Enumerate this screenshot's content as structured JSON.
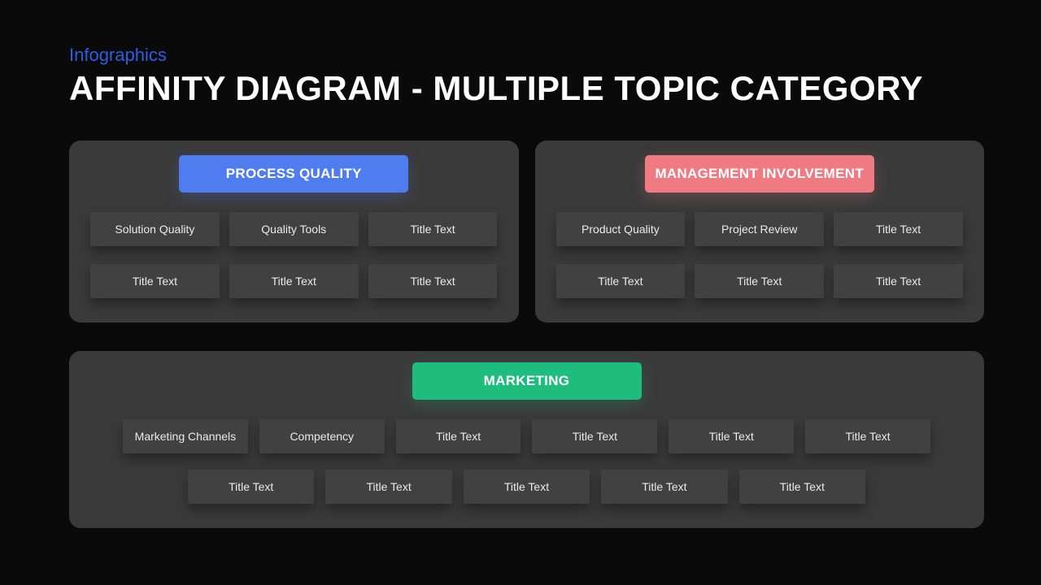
{
  "eyebrow": "Infographics",
  "title": "AFFINITY DIAGRAM - MULTIPLE TOPIC CATEGORY",
  "colors": {
    "blue": "#4f7df0",
    "pink": "#f07a82",
    "green": "#1fbd7d",
    "panel_bg": "#3a3a3a",
    "cell_bg": "#414141"
  },
  "groups": [
    {
      "id": "process-quality",
      "header": "PROCESS QUALITY",
      "color": "blue",
      "items": [
        "Solution Quality",
        "Quality Tools",
        "Title Text",
        "Title Text",
        "Title Text",
        "Title Text"
      ]
    },
    {
      "id": "management-involvement",
      "header": "MANAGEMENT INVOLVEMENT",
      "color": "pink",
      "items": [
        "Product Quality",
        "Project Review",
        "Title Text",
        "Title Text",
        "Title Text",
        "Title Text"
      ]
    },
    {
      "id": "marketing",
      "header": "MARKETING",
      "color": "green",
      "row1": [
        "Marketing Channels",
        "Competency",
        "Title Text",
        "Title Text",
        "Title Text",
        "Title Text"
      ],
      "row2": [
        "Title Text",
        "Title Text",
        "Title Text",
        "Title Text",
        "Title Text"
      ]
    }
  ]
}
